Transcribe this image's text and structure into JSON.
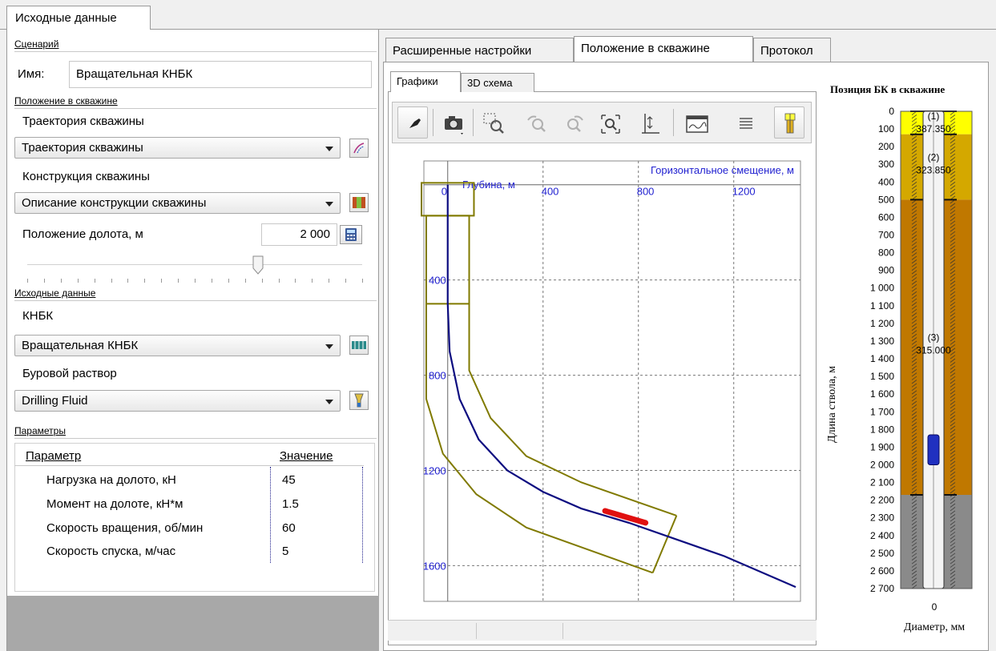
{
  "top_tab": {
    "label": "Исходные данные"
  },
  "scenario": {
    "group_title": "Сценарий",
    "name_label": "Имя:",
    "name_value": "Вращательная КНБК"
  },
  "position": {
    "group_title": "Положение в скважине",
    "trajectory_label": "Траектория скважины",
    "trajectory_value": "Траектория скважины",
    "construction_label": "Конструкция скважины",
    "construction_value": "Описание конструкции скважины",
    "bit_position_label": "Положение долота, м",
    "bit_position_value": "2 000",
    "slider_value": 0.69
  },
  "source_data": {
    "group_title": "Исходные данные",
    "bha_label": "КНБК",
    "bha_value": "Вращательная КНБК",
    "fluid_label": "Буровой раствор",
    "fluid_value": "Drilling Fluid"
  },
  "params": {
    "group_title": "Параметры",
    "col_param": "Параметр",
    "col_value": "Значение",
    "rows": [
      {
        "name": "Нагрузка на долото, кН",
        "value": "45"
      },
      {
        "name": "Момент на долоте, кН*м",
        "value": "1.5"
      },
      {
        "name": "Скорость вращения, об/мин",
        "value": "60"
      },
      {
        "name": "Скорость спуска, м/час",
        "value": "5"
      }
    ]
  },
  "right_tabs": [
    {
      "label": "Расширенные настройки",
      "active": false
    },
    {
      "label": "Положение в скважине",
      "active": true
    },
    {
      "label": "Протокол",
      "active": false
    }
  ],
  "sub_tabs": [
    {
      "label": "Графики",
      "active": true
    },
    {
      "label": "3D схема",
      "active": false
    }
  ],
  "toolbar_icons": [
    "pin-icon",
    "camera-icon",
    "zoom-select-icon",
    "undo-zoom-icon",
    "redo-zoom-icon",
    "zoom-fit-icon",
    "axis-scale-icon",
    "chart-window-icon",
    "legend-icon",
    "well-schema-icon"
  ],
  "chart": {
    "x_title": "Горизонтальное смещение, м",
    "y_title": "Глубина, м",
    "x_ticks": [
      "0",
      "400",
      "800",
      "1200"
    ],
    "y_ticks": [
      "400",
      "800",
      "1200",
      "1600"
    ]
  },
  "chart_data": {
    "type": "line",
    "xlabel": "Горизонтальное смещение, м",
    "ylabel": "Глубина, м",
    "xlim": [
      -100,
      1480
    ],
    "ylim": [
      -100,
      1750
    ],
    "x_ticks": [
      0,
      400,
      800,
      1200
    ],
    "y_ticks": [
      400,
      800,
      1200,
      1600
    ],
    "grid": true,
    "series": [
      {
        "x": [
          0,
          0,
          0,
          8,
          50,
          130,
          250,
          400,
          560,
          760,
          960,
          1160,
          1460
        ],
        "y": [
          0,
          200,
          500,
          700,
          900,
          1070,
          1200,
          1290,
          1360,
          1420,
          1490,
          1560,
          1690
        ]
      }
    ],
    "bit_segment": {
      "x": [
        660,
        830
      ],
      "y": [
        1370,
        1420
      ]
    }
  },
  "well_position": {
    "title": "Позиция БК в скважине",
    "y_label": "Длина ствола, м",
    "x_label": "Диаметр, мм",
    "x_tick": "0",
    "ticks": [
      "0",
      "100",
      "200",
      "300",
      "400",
      "500",
      "600",
      "700",
      "800",
      "900",
      "1 000",
      "1 100",
      "1 200",
      "1 300",
      "1 400",
      "1 500",
      "1 600",
      "1 700",
      "1 800",
      "1 900",
      "2 000",
      "2 100",
      "2 200",
      "2 300",
      "2 400",
      "2 500",
      "2 600",
      "2 700"
    ],
    "sections": [
      {
        "label": "(1)",
        "value": "387.350",
        "from": 0,
        "to": 130,
        "color": "#ffff00"
      },
      {
        "label": "(2)",
        "value": "323.850",
        "from": 130,
        "to": 500,
        "color": "#d4a800"
      },
      {
        "label": "(3)",
        "value": "315.000",
        "from": 500,
        "to": 2170,
        "color": "#c07800"
      }
    ],
    "below_color": "#8a8a8a",
    "bit_from": 1830,
    "bit_to": 2000
  }
}
